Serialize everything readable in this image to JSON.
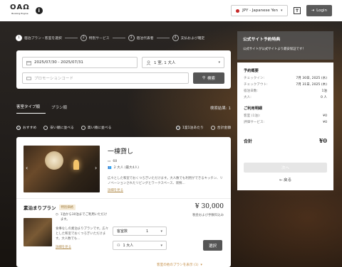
{
  "header": {
    "logo": "ОАΩ",
    "logo_sub": "Booking Engine",
    "info_icon": "info-icon",
    "currency_label": "JPY - Japanese Yen",
    "login_label": "Login"
  },
  "steps": [
    {
      "num": "1",
      "label": "宿泊プラン・客室を選択"
    },
    {
      "num": "2",
      "label": "特別サービス"
    },
    {
      "num": "3",
      "label": "宿泊代表者"
    },
    {
      "num": "4",
      "label": "支払および確定"
    }
  ],
  "search": {
    "dates": "2025/07/30 - 2025/07/31",
    "guests": "1 室, 1 大人",
    "promo_placeholder": "プロモーションコード",
    "search_label": "検索"
  },
  "tabs": [
    "客室タイプ順",
    "プラン順"
  ],
  "results_label": "検索結果: 1",
  "sort": {
    "options": [
      "おすすめ",
      "安い順に並べる",
      "高い順に並べる"
    ],
    "right_options": [
      "1室1泊あたり",
      "合計金額"
    ]
  },
  "room": {
    "title": "一棟貸し",
    "size": "68",
    "capacity": "2 大人 (最大4人)",
    "description": "広々とした和室でおくつろぎいただけます。大人数でも利用ができるキッチン、リノベーションされたリビングとワークスペース、新鮮...",
    "more_label": "詳細を見る"
  },
  "plan": {
    "name": "素泊まりプラン",
    "badge": "特別価格",
    "price": "¥ 30,000",
    "tax_note": "税金および手数料込み",
    "min_stay_note": "1泊から30泊までご利用いただけます。",
    "description": "食事なしの素泊まりプランです。広々とした和室でおくつろぎいただけます。大人数でも...",
    "more_label": "詳細を見る",
    "rooms_label": "客室数",
    "rooms_value": "1",
    "guests_value": "1 大人",
    "select_label": "選択",
    "other_plans_label": "客室の他のプランを表示 (1)"
  },
  "side": {
    "header_title": "公式サイト予約特典",
    "header_sub": "公式サイトが公式サイトより最安保証です！",
    "summary_title": "予約概要",
    "rows": [
      {
        "label": "チェックイン:",
        "value": "7月 30日, 2025 (水)"
      },
      {
        "label": "チェックアウト:",
        "value": "7月 31日, 2025 (木)"
      },
      {
        "label": "宿泊日数:",
        "value": "1泊"
      },
      {
        "label": "大人:",
        "value": "0 人"
      }
    ],
    "detail_title": "ご利用明細",
    "detail_rows": [
      {
        "label": "客室 (1泊):",
        "value": "¥0"
      },
      {
        "label": "評価サービス:",
        "value": "¥0"
      }
    ],
    "total_label": "合計",
    "total_value": "¥0",
    "next_label": "次へ",
    "back_label": "← 戻る"
  }
}
